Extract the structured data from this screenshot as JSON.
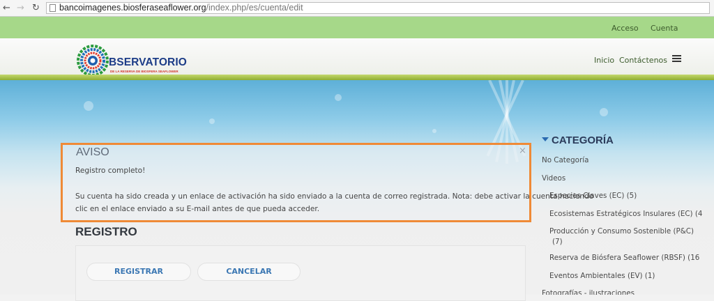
{
  "browser": {
    "url_domain": "bancoimagenes.biosferaseaflower.org",
    "url_path": "/index.php/es/cuenta/edit"
  },
  "topbar": {
    "acceso": "Acceso",
    "cuenta": "Cuenta"
  },
  "header": {
    "logo_text": "BSERVATORIO",
    "logo_subtext": "DE LA RESERVA DE BIOSFERA SEAFLOWER",
    "nav": {
      "inicio": "Inicio",
      "contactenos": "Contáctenos"
    }
  },
  "alert": {
    "title": "AVISO",
    "close": "×",
    "line1": "Registro completo!",
    "line2": "Su cuenta ha sido creada y un enlace de activación ha sido enviado a la cuenta de correo registrada. Nota: debe activar la cuenta haciendo",
    "line3": "clic en el enlace enviado a su E-mail antes de que pueda acceder."
  },
  "registro": {
    "title": "REGISTRO",
    "registrar_label": "REGISTRAR",
    "cancelar_label": "CANCELAR"
  },
  "sidebar": {
    "title": "CATEGORÍA",
    "items": [
      "No Categoría",
      "Videos",
      "Especies Claves (EC) (5)",
      "Ecosistemas Estratégicos Insulares (EC) (4",
      "Producción y Consumo Sostenible (P&C)",
      "(7)",
      "Reserva de Biósfera Seaflower (RBSF) (16",
      "Eventos Ambientales (EV) (1)",
      "Fotografías - ilustraciones"
    ]
  },
  "colors": {
    "topbar": "#a6d889",
    "alert_border": "#ef8a36",
    "button_text": "#3b77b3",
    "logo_blue": "#1c3c87"
  }
}
